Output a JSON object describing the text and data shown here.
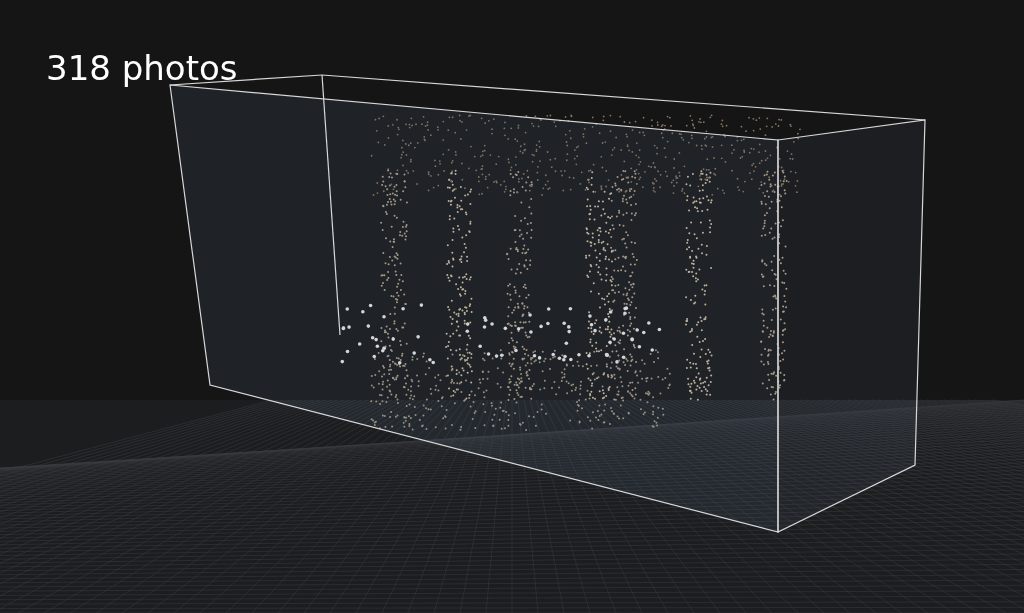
{
  "viewport": {
    "photo_count": "318 photos"
  }
}
